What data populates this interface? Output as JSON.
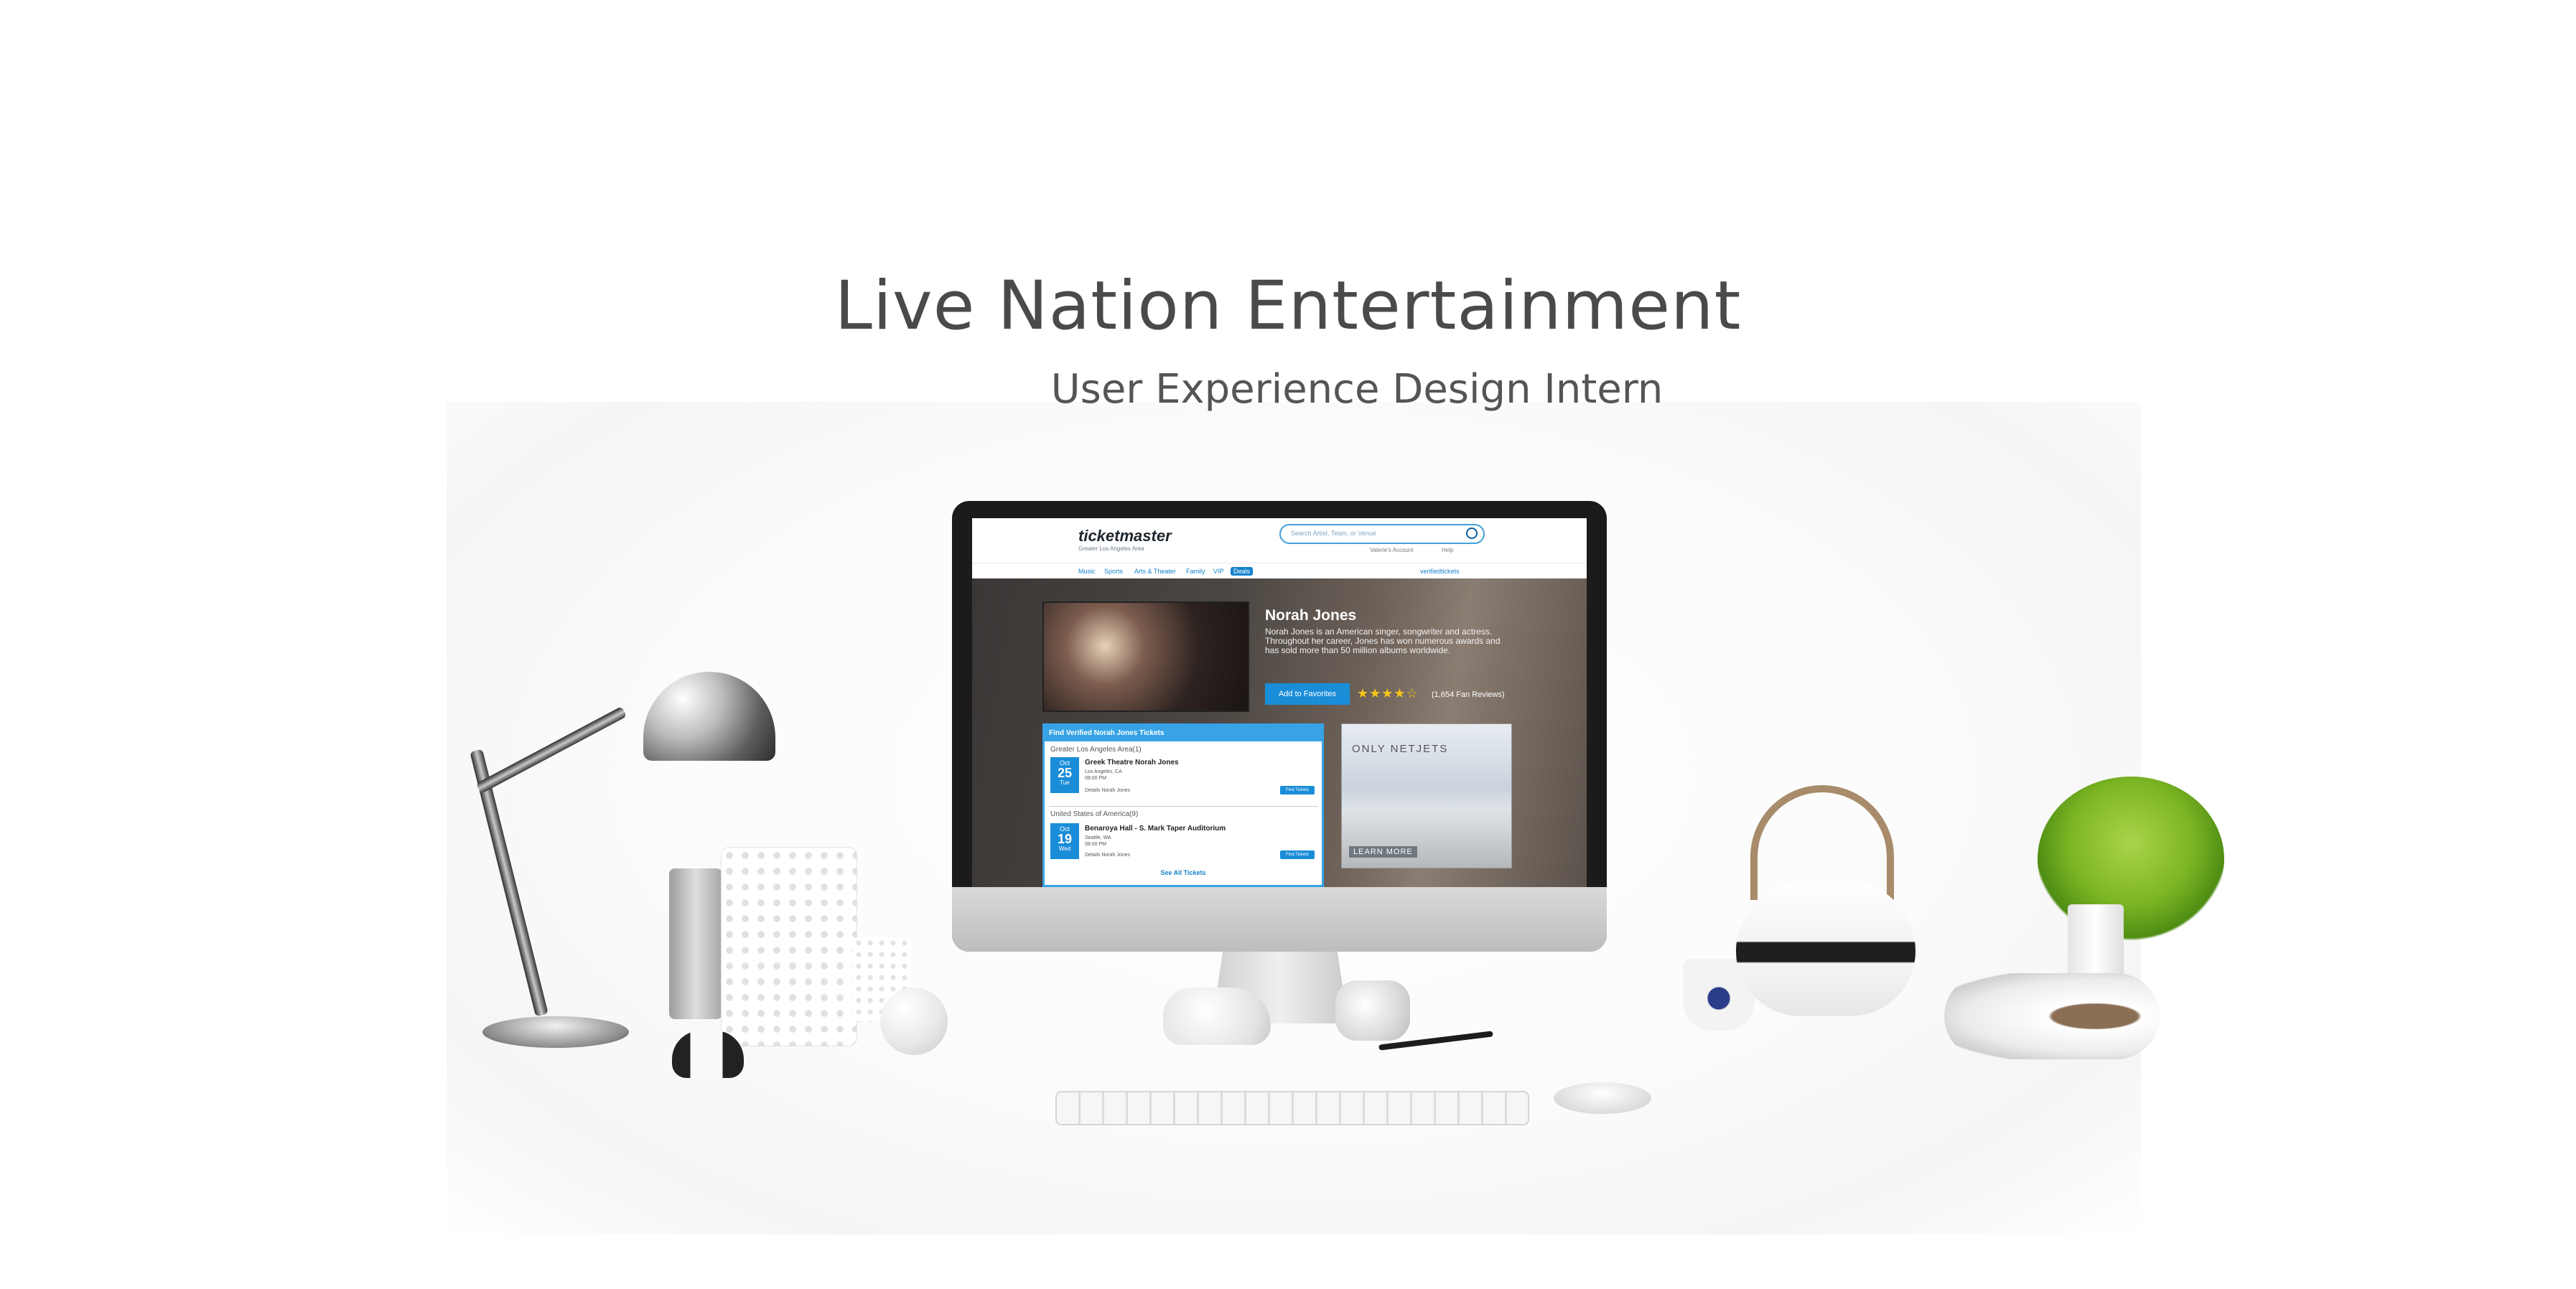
{
  "heading": {
    "title": "Live Nation Entertainment",
    "subtitle": "User Experience Design Intern"
  },
  "site": {
    "logo": "ticketmaster",
    "location": "Greater Los Angeles Area",
    "search_placeholder": "Search Artist, Team, or Venue",
    "account": "Valerie's Account",
    "help": "Help",
    "verified": "verifiedtickets",
    "nav": [
      "Music",
      "Sports",
      "Arts & Theater",
      "Family",
      "VIP",
      "Deals"
    ],
    "artist": {
      "name": "Norah Jones",
      "bio": "Norah Jones is an American singer, songwriter and actress. Throughout her career, Jones has won numerous awards and has sold more than 50 million albums worldwide.",
      "favorite_label": "Add to Favorites",
      "rating": 4,
      "rating_stars": "★★★★☆",
      "reviews": "(1,654 Fan Reviews)"
    },
    "tickets": {
      "heading": "Find Verified Norah Jones Tickets",
      "groups": [
        {
          "label": "Greater Los Angeles Area(1)",
          "event": {
            "month": "Oct",
            "day": "25",
            "weekday": "Tue",
            "venue": "Greek Theatre Norah Jones",
            "city": "Los Angeles, CA",
            "time": "08:00 PM",
            "details": "Details Norah Jones",
            "button": "Find Tickets"
          }
        },
        {
          "label": "United States of America(9)",
          "event": {
            "month": "Oct",
            "day": "19",
            "weekday": "Wed",
            "venue": "Benaroya Hall - S. Mark Taper Auditorium",
            "city": "Seattle, WA",
            "time": "08:00 PM",
            "details": "Details Norah Jones",
            "button": "Find Tickets"
          }
        }
      ],
      "see_all": "See All Tickets"
    },
    "ad": {
      "brand": "ONLY NETJETS",
      "cta": "LEARN MORE"
    }
  },
  "colors": {
    "accent": "#1a8dd8",
    "heading": "#4a4a4a"
  }
}
